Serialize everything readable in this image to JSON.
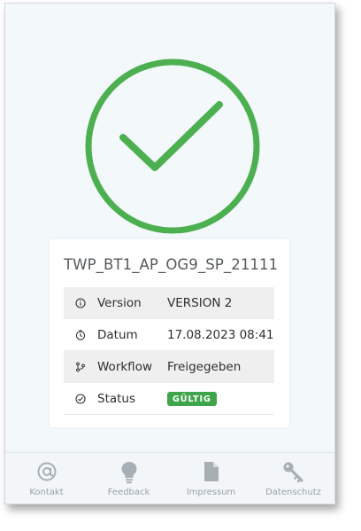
{
  "status_icon": {
    "name": "check-circle-icon",
    "color": "#4caf50"
  },
  "document": {
    "title": "TWP_BT1_AP_OG9_SP_21111",
    "rows": [
      {
        "icon": "info-icon",
        "label": "Version",
        "value": "VERSION 2"
      },
      {
        "icon": "clock-icon",
        "label": "Datum",
        "value": "17.08.2023 08:41"
      },
      {
        "icon": "workflow-icon",
        "label": "Workflow",
        "value": "Freigegeben"
      },
      {
        "icon": "check-circle-small-icon",
        "label": "Status",
        "badge": "GÜLTIG"
      }
    ]
  },
  "footer": {
    "items": [
      {
        "icon": "at-icon",
        "label": "Kontakt"
      },
      {
        "icon": "lightbulb-icon",
        "label": "Feedback"
      },
      {
        "icon": "document-icon",
        "label": "Impressum"
      },
      {
        "icon": "key-icon",
        "label": "Datenschutz"
      }
    ]
  },
  "colors": {
    "accent": "#4caf50",
    "badge": "#3fa54a",
    "footer_text": "#9aa1a7"
  }
}
